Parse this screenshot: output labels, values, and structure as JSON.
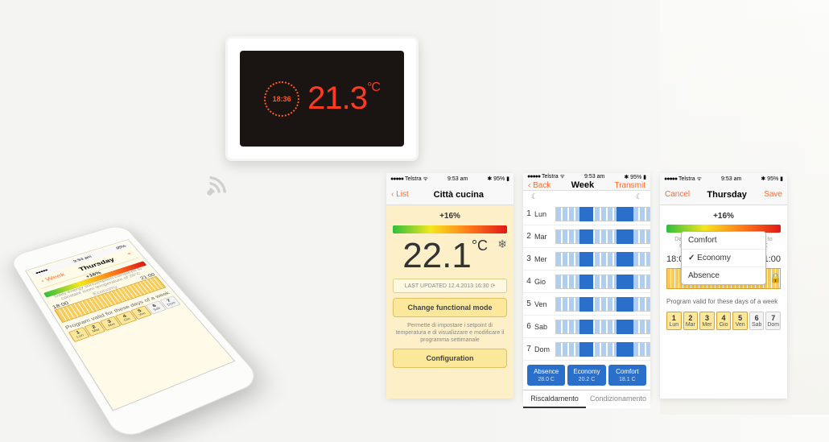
{
  "thermostat": {
    "time": "18:36",
    "temp": "21.3",
    "unit": "°C"
  },
  "status": {
    "carrier": "Telstra",
    "time": "9:53 am",
    "battery": "95%"
  },
  "screen1": {
    "nav_left": "‹ List",
    "title": "Città cucina",
    "pct": "+16%",
    "temp": "22.1",
    "unit": "°C",
    "updated": "LAST UPDATED 12.4.2013  16:30",
    "change_mode": "Change functional mode",
    "desc": "Permette di impostare i setpoint di temperatura e di visualizzare e modificare il programma settimanale",
    "config": "Configuration"
  },
  "screen2": {
    "nav_left": "‹ Back",
    "title": "Week",
    "nav_right": "Transmit",
    "days": [
      {
        "n": "1",
        "l": "Lun"
      },
      {
        "n": "2",
        "l": "Mar"
      },
      {
        "n": "3",
        "l": "Mer"
      },
      {
        "n": "4",
        "l": "Gio"
      },
      {
        "n": "5",
        "l": "Ven"
      },
      {
        "n": "6",
        "l": "Sab"
      },
      {
        "n": "7",
        "l": "Dom"
      }
    ],
    "modes": [
      {
        "name": "Absence",
        "t": "28.0 C"
      },
      {
        "name": "Economy",
        "t": "20.2 C"
      },
      {
        "name": "Comfort",
        "t": "18.1 C"
      }
    ],
    "tab_heat": "Riscaldamento",
    "tab_cool": "Condizionamento"
  },
  "screen3": {
    "nav_left": "Cancel",
    "title": "Thursday",
    "nav_right": "Save",
    "pct": "+16%",
    "note": "Daily energy consumption compared to constant room temperature of 20°C",
    "t1": "18:00",
    "mode": "Economy",
    "t2": "21:00",
    "options": [
      "Comfort",
      "Economy",
      "Absence"
    ],
    "selected": "Economy",
    "progtxt": "Program valid for these days of a week",
    "chips": [
      {
        "n": "1",
        "l": "Lun",
        "on": true
      },
      {
        "n": "2",
        "l": "Mar",
        "on": true
      },
      {
        "n": "3",
        "l": "Mer",
        "on": true
      },
      {
        "n": "4",
        "l": "Gio",
        "on": true
      },
      {
        "n": "5",
        "l": "Ven",
        "on": true
      },
      {
        "n": "6",
        "l": "Sab",
        "on": false
      },
      {
        "n": "7",
        "l": "Dom",
        "on": false
      }
    ]
  },
  "persp": {
    "nav_left": "‹ Week",
    "title": "Thursday"
  }
}
